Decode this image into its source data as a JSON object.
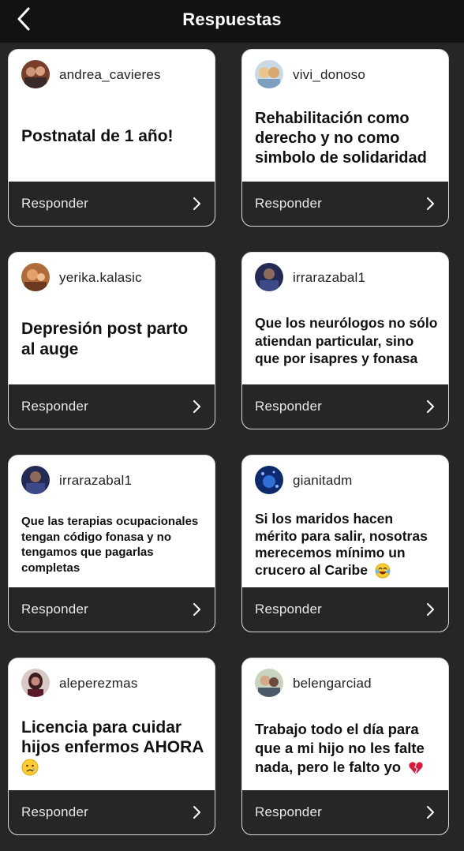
{
  "header": {
    "title": "Respuestas",
    "back_icon": "chevron-left-icon"
  },
  "cards": [
    {
      "username": "andrea_cavieres",
      "text": "Postnatal de 1 año!",
      "respond_label": "Responder",
      "avatar_colors": [
        "#7a3f2a",
        "#c9967a"
      ]
    },
    {
      "username": "vivi_donoso",
      "text": "Rehabilitación como derecho y no como simbolo de solidaridad",
      "respond_label": "Responder",
      "avatar_colors": [
        "#a6c2d8",
        "#e9c48c"
      ]
    },
    {
      "username": "yerika.kalasic",
      "text": "Depresión post parto al auge",
      "respond_label": "Responder",
      "avatar_colors": [
        "#b06b3a",
        "#e6a06a"
      ]
    },
    {
      "username": "irrarazabal1",
      "text": "Que los neurólogos no sólo atiendan particular, sino que por isapres y fonasa",
      "respond_label": "Responder",
      "avatar_colors": [
        "#232a55",
        "#8d6a5a"
      ]
    },
    {
      "username": "irrarazabal1",
      "text": "Que las terapias ocupacionales tengan código fonasa y no tengamos que pagarlas completas",
      "respond_label": "Responder",
      "avatar_colors": [
        "#232a55",
        "#8d6a5a"
      ]
    },
    {
      "username": "gianitadm",
      "text": "Si los maridos hacen mérito para salir, nosotras merecemos mínimo un crucero al Caribe",
      "emoji": "laughing-crying-emoji",
      "respond_label": "Responder",
      "avatar_colors": [
        "#0d2a6e",
        "#2f6fd6"
      ]
    },
    {
      "username": "aleperezmas",
      "text": "Licencia para cuidar hijos enfermos AHORA",
      "emoji": "crying-emoji",
      "respond_label": "Responder",
      "avatar_colors": [
        "#3a1e1e",
        "#c4897a"
      ]
    },
    {
      "username": "belengarciad",
      "text": "Trabajo todo el día para que a mi hijo no les falte nada, pero le falto yo",
      "emoji": "broken-heart-emoji",
      "respond_label": "Responder",
      "avatar_colors": [
        "#6d4a3a",
        "#d6a88a"
      ]
    }
  ]
}
